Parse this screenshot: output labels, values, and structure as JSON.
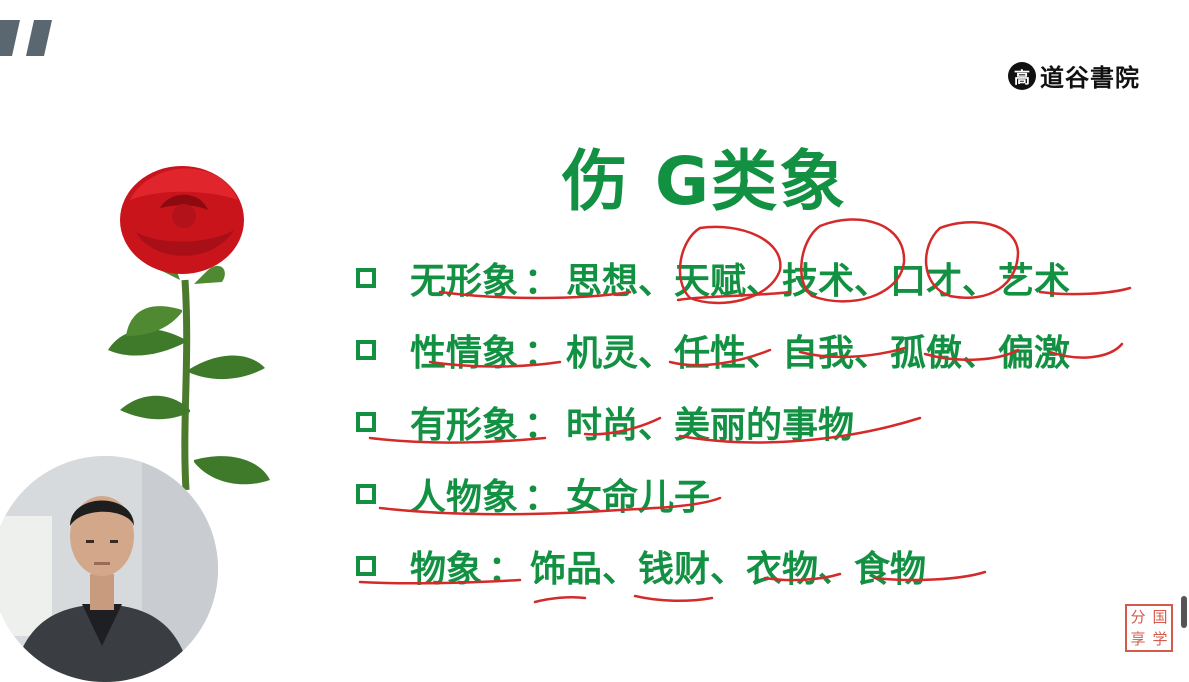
{
  "brand": {
    "seal_char": "高",
    "name": "道谷書院"
  },
  "slide": {
    "title": "伤 G类象",
    "items": [
      {
        "label": "无形象",
        "colon": "：",
        "text": "思想、天赋、技术、口才、艺术"
      },
      {
        "label": "性情象",
        "colon": "：",
        "text": "机灵、任性、自我、孤傲、偏激"
      },
      {
        "label": "有形象",
        "colon": "：",
        "text": "时尚、美丽的事物"
      },
      {
        "label": "人物象",
        "colon": "：",
        "text": "女命儿子"
      },
      {
        "label": "物象",
        "colon": "：",
        "text": "饰品、钱财、衣物、食物"
      }
    ]
  },
  "stamp": {
    "chars": [
      "分",
      "国",
      "享",
      "学"
    ]
  },
  "colors": {
    "text_green": "#129142",
    "ink_red": "#d42a2a",
    "stamp_red": "#d65a4a"
  }
}
